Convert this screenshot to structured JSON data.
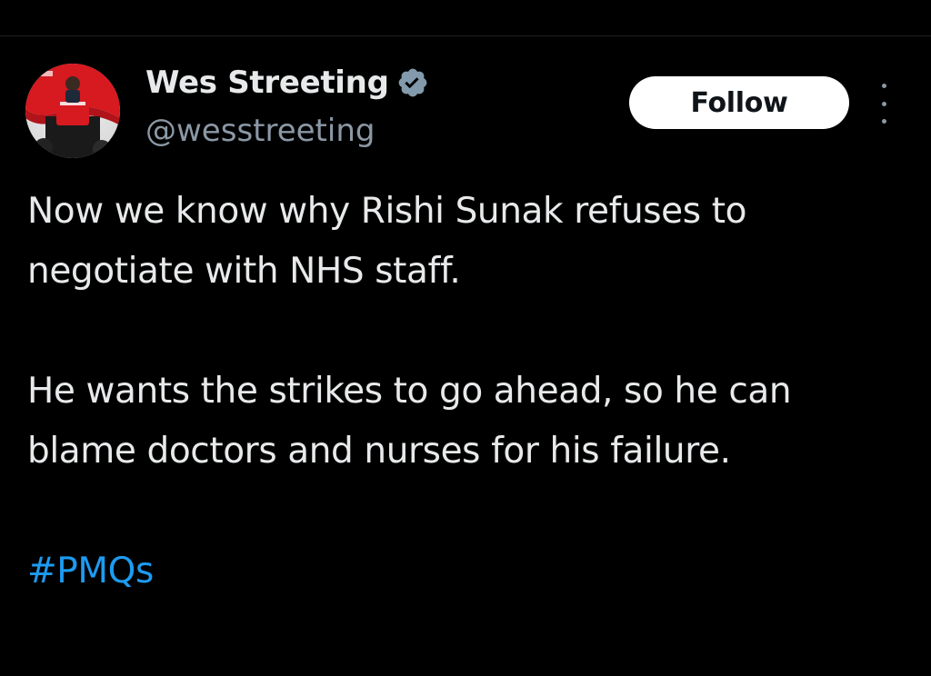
{
  "tweet": {
    "author": {
      "display_name": "Wes Streeting",
      "handle": "@wesstreeting",
      "verified_icon": "verified-badge-icon",
      "avatar_icon": "profile-avatar"
    },
    "follow_label": "Follow",
    "more_icon": "more-options-icon",
    "paragraphs": [
      "Now we know why Rishi Sunak refuses to negotiate with NHS staff.",
      "He wants the strikes to go ahead, so he can blame doctors and nurses for his failure."
    ],
    "hashtag": "#PMQs"
  },
  "colors": {
    "background": "#000000",
    "text_primary": "#e7e9ea",
    "text_secondary": "#8b98a5",
    "link": "#1d9bf0",
    "follow_button_bg": "#ffffff",
    "follow_button_text": "#0f1419",
    "verified_badge": "#829aab",
    "avatar_brand": "#d71920"
  }
}
